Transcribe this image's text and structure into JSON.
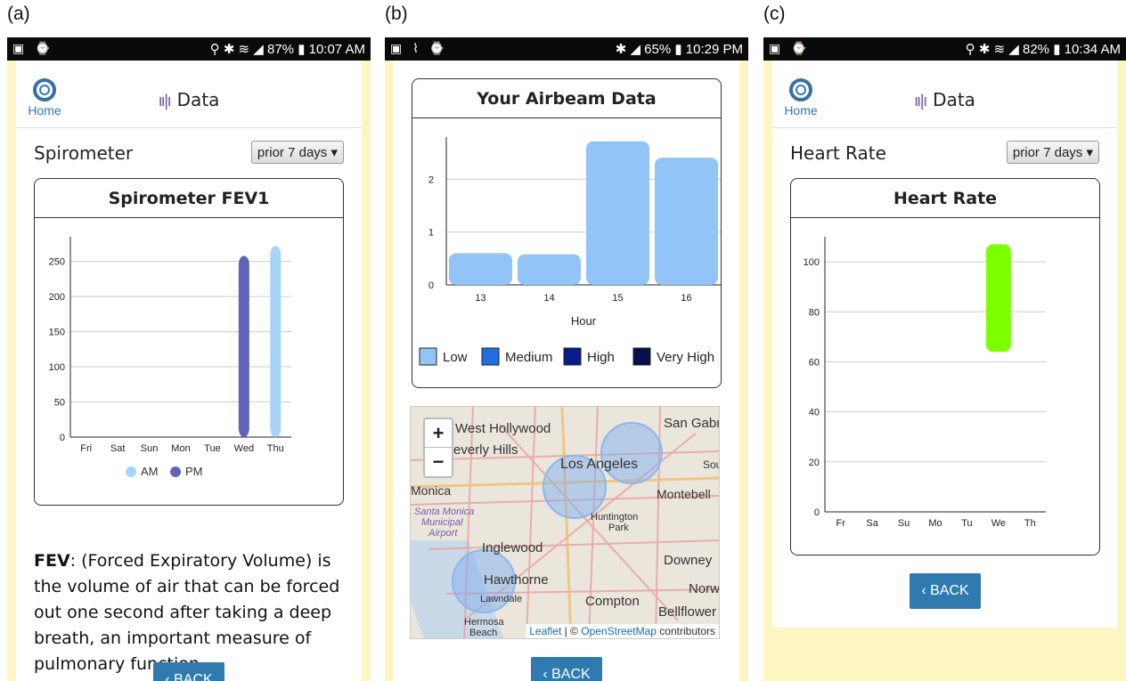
{
  "panels": [
    {
      "label": "(a)",
      "status": {
        "left": "▣ ⌚",
        "right": "⚲ ✱ ≋ ◢ 87% ▮ 10:07 AM"
      },
      "app": {
        "home_label": "Home",
        "title": "Data"
      },
      "section_title": "Spirometer",
      "range_select": "prior 7 days ▾",
      "card_title": "Spirometer FEV1",
      "description": {
        "term": "FEV",
        "text": ": (Forced Expiratory Volume) is the volume of air that can be forced out one second after taking a deep breath, an important measure of pulmonary function."
      },
      "back_label": "‹ BACK"
    },
    {
      "label": "(b)",
      "status": {
        "left": "▣ ⌇ ⌚",
        "right": "✱ ◢ 65% ▮ 10:29 PM"
      },
      "card_title": "Your Airbeam Data",
      "map": {
        "zoom_in": "+",
        "zoom_out": "−",
        "places": [
          "West Hollywood",
          "Beverly Hills",
          "San Gabri",
          "Los Angeles",
          "Sou",
          "Monica",
          "Montebell",
          "Santa Monica",
          "Municipal",
          "Airport",
          "Huntington",
          "Park",
          "Inglewood",
          "Downey",
          "Hawthorne",
          "Norw",
          "Lawndale",
          "Compton",
          "Bellflower",
          "Hermosa",
          "Beach"
        ],
        "attribution_link1": "Leaflet",
        "attribution_sep": " | © ",
        "attribution_link2": "OpenStreetMap",
        "attribution_tail": " contributors"
      },
      "back_label": "‹ BACK"
    },
    {
      "label": "(c)",
      "status": {
        "left": "▣ ⌚",
        "right": "⚲ ✱ ≋ ◢ 82% ▮ 10:34 AM"
      },
      "app": {
        "home_label": "Home",
        "title": "Data"
      },
      "section_title": "Heart Rate",
      "range_select": "prior 7 days ▾",
      "card_title": "Heart Rate",
      "back_label": "‹ BACK"
    }
  ],
  "chart_data": [
    {
      "type": "bar",
      "title": "Spirometer FEV1",
      "categories": [
        "Fri",
        "Sat",
        "Sun",
        "Mon",
        "Tue",
        "Wed",
        "Thu"
      ],
      "series": [
        {
          "name": "AM",
          "color": "#a8d4f7",
          "values": [
            null,
            null,
            null,
            null,
            null,
            null,
            272
          ]
        },
        {
          "name": "PM",
          "color": "#6064b8",
          "values": [
            null,
            null,
            null,
            null,
            null,
            258,
            null
          ]
        }
      ],
      "yticks": [
        0,
        50,
        100,
        150,
        200,
        250
      ],
      "ylim": [
        0,
        285
      ],
      "legend": "bottom"
    },
    {
      "type": "bar",
      "categories": [
        "13",
        "14",
        "15",
        "16"
      ],
      "values": [
        0.6,
        0.58,
        2.72,
        2.41
      ],
      "bar_color": "#92c4f7",
      "xlabel": "Hour",
      "yticks": [
        0,
        1,
        2
      ],
      "ylim": [
        0,
        2.8
      ],
      "legend": "bottom",
      "legend_entries": [
        {
          "name": "Low",
          "color": "#92c4f7"
        },
        {
          "name": "Medium",
          "color": "#1f6fe0"
        },
        {
          "name": "High",
          "color": "#0a1a8c"
        },
        {
          "name": "Very High",
          "color": "#06104f"
        }
      ]
    },
    {
      "type": "bar",
      "title": "Heart Rate",
      "categories": [
        "Fr",
        "Sa",
        "Su",
        "Mo",
        "Tu",
        "We",
        "Th"
      ],
      "ranges": [
        null,
        null,
        null,
        null,
        null,
        [
          64,
          107
        ],
        null
      ],
      "bar_color": "#7cff00",
      "yticks": [
        0,
        20,
        40,
        60,
        80,
        100
      ],
      "ylim": [
        0,
        110
      ]
    }
  ]
}
